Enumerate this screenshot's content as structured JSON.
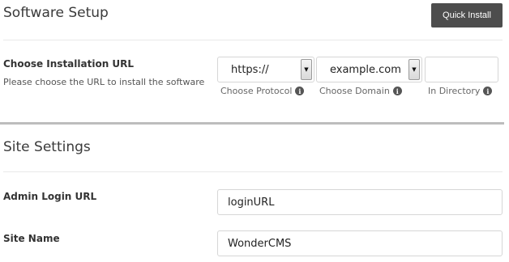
{
  "software_setup": {
    "title": "Software Setup",
    "quick_install_label": "Quick Install"
  },
  "installation_url": {
    "label": "Choose Installation URL",
    "description": "Please choose the URL to install the software",
    "protocol": {
      "value": "https://",
      "hint": "Choose Protocol"
    },
    "domain": {
      "value": "example.com",
      "hint": "Choose Domain"
    },
    "directory": {
      "value": "",
      "hint": "In Directory"
    }
  },
  "site_settings": {
    "title": "Site Settings",
    "admin_login_url": {
      "label": "Admin Login URL",
      "value": "loginURL"
    },
    "site_name": {
      "label": "Site Name",
      "value": "WonderCMS"
    }
  },
  "icons": {
    "info": "info-icon",
    "dropdown": "chevron-down-icon"
  }
}
